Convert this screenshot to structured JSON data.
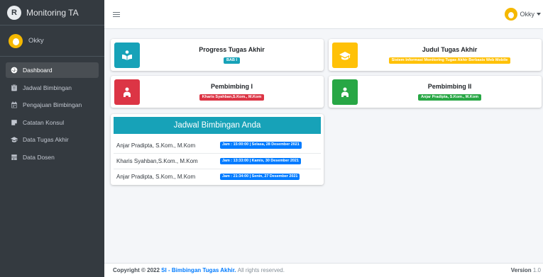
{
  "brand": {
    "title": "Monitoring TA",
    "logo_letter": "R"
  },
  "sidebar": {
    "user_name": "Okky",
    "items": [
      {
        "label": "Dashboard",
        "icon": "dashboard-icon",
        "active": true
      },
      {
        "label": "Jadwal Bimbingan",
        "icon": "clipboard-icon",
        "active": false
      },
      {
        "label": "Pengajuan Bimbingan",
        "icon": "calendar-icon",
        "active": false
      },
      {
        "label": "Catatan Konsul",
        "icon": "note-icon",
        "active": false
      },
      {
        "label": "Data Tugas Akhir",
        "icon": "graduation-cap-icon",
        "active": false
      },
      {
        "label": "Data Dosen",
        "icon": "user-tie-icon",
        "active": false
      }
    ]
  },
  "topbar": {
    "user_name": "Okky"
  },
  "info_boxes": {
    "progress": {
      "title": "Progress Tugas Akhir",
      "badge": "BAB I"
    },
    "judul": {
      "title": "Judul Tugas Akhir",
      "badge": "Sistem Informasi Monitoring Tugas Akhir Berbasis Web Mobile"
    },
    "pembimbing1": {
      "title": "Pembimbing I",
      "badge": "Kharis Syahban,S.Kom., M.Kom"
    },
    "pembimbing2": {
      "title": "Pembimbing II",
      "badge": "Anjar Pradipta, S.Kom., M.Kom"
    }
  },
  "schedule": {
    "title": "Jadwal Bimbingan Anda",
    "rows": [
      {
        "name": "Anjar Pradipta, S.Kom., M.Kom",
        "time": "Jam : 15:00:00 | Selasa, 28 Desember 2021"
      },
      {
        "name": "Kharis Syahban,S.Kom., M.Kom",
        "time": "Jam : 13:33:00 | Kamis, 30 Desember 2021"
      },
      {
        "name": "Anjar Pradipta, S.Kom., M.Kom",
        "time": "Jam : 21:34:00 | Senin, 27 Desember 2021"
      }
    ]
  },
  "footer": {
    "copyright_prefix": "Copyright © 2022",
    "link": "SI - Bimbingan Tugas Akhir.",
    "suffix": "All rights reserved.",
    "version_label": "Version",
    "version_value": "1.0"
  },
  "colors": {
    "sidebar": "#343a40",
    "info": "#17a2b8",
    "warning": "#ffc107",
    "danger": "#dc3545",
    "success": "#28a745",
    "primary": "#007bff"
  }
}
